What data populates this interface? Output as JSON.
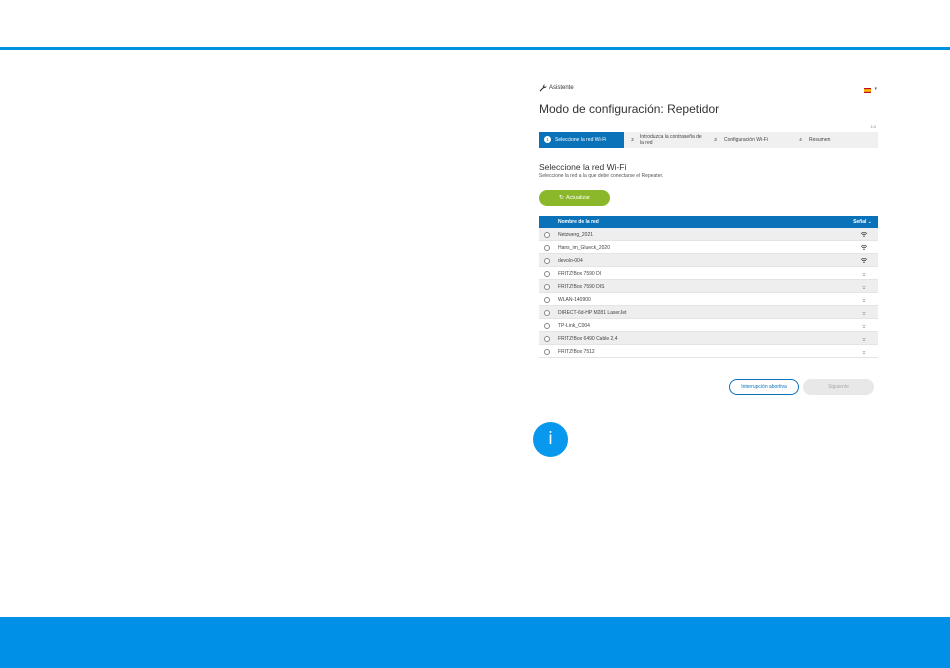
{
  "header": {
    "assistant_label": "Asistente",
    "language_icon": "spain-flag-icon"
  },
  "title": "Modo de configuración: Repetidor",
  "step_counter": "1/4",
  "steps": [
    {
      "num": "1",
      "label": "Seleccione la red Wi-Fi",
      "active": true
    },
    {
      "num": "2",
      "label": "Introduzca la contraseña de la red",
      "active": false
    },
    {
      "num": "3",
      "label": "Configuración Wi-Fi",
      "active": false
    },
    {
      "num": "4",
      "label": "Resumen",
      "active": false
    }
  ],
  "section": {
    "title": "Seleccione la red Wi-Fi",
    "subtitle": "Seleccione la red a la que debe conectarse el Repeater."
  },
  "refresh_label": "Actualizar",
  "table": {
    "col_name": "Nombre de la red",
    "col_signal": "Señal",
    "rows": [
      {
        "name": "Netzwerg_2021",
        "signal": "strong"
      },
      {
        "name": "Hans_im_Glueck_2020",
        "signal": "strong"
      },
      {
        "name": "devolo-004",
        "signal": "strong"
      },
      {
        "name": "FRITZ!Box 7590 DI",
        "signal": "weak"
      },
      {
        "name": "FRITZ!Box 7590 DIS",
        "signal": "weak"
      },
      {
        "name": "WLAN-140900",
        "signal": "weak"
      },
      {
        "name": "DIRECT-6d-HP M281 LaserJet",
        "signal": "weak"
      },
      {
        "name": "TP-Link_C004",
        "signal": "weak"
      },
      {
        "name": "FRITZ!Box 6490 Cable 2,4",
        "signal": "weak"
      },
      {
        "name": "FRITZ!Box 7512",
        "signal": "weak"
      }
    ]
  },
  "buttons": {
    "abort": "Interrupción abortiva",
    "next": "Siguiente"
  },
  "info_icon_label": "i",
  "colors": {
    "accent": "#0a72b8",
    "refresh": "#8ab82a",
    "band": "#0090e8"
  }
}
